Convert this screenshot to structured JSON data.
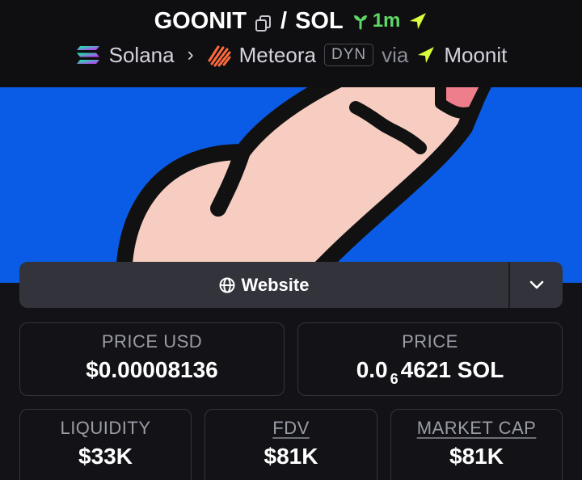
{
  "header": {
    "token": "GOONIT",
    "separator": "/",
    "quote": "SOL",
    "age": "1m",
    "chain": "Solana",
    "dex": "Meteora",
    "pool_type": "DYN",
    "via": "via",
    "launchpad": "Moonit"
  },
  "links": {
    "website_label": "Website"
  },
  "stats": {
    "price_usd_label": "PRICE USD",
    "price_usd_value": "$0.00008136",
    "price_label": "PRICE",
    "price_prefix": "0.0",
    "price_zeros": "6",
    "price_digits": "4621",
    "price_unit": "SOL",
    "liquidity_label": "LIQUIDITY",
    "liquidity_value": "$33K",
    "fdv_label": "FDV",
    "fdv_value": "$81K",
    "mcap_label": "MARKET CAP",
    "mcap_value": "$81K"
  },
  "colors": {
    "age_green": "#5fd866",
    "moonit_yellow": "#d7ff3a",
    "banner_blue": "#0a5ce6"
  },
  "icons": [
    "copy-icon",
    "sprout-icon",
    "moonit-arrow-icon",
    "solana-logo",
    "meteora-logo",
    "chevron-right-icon",
    "globe-icon",
    "chevron-down-icon"
  ]
}
